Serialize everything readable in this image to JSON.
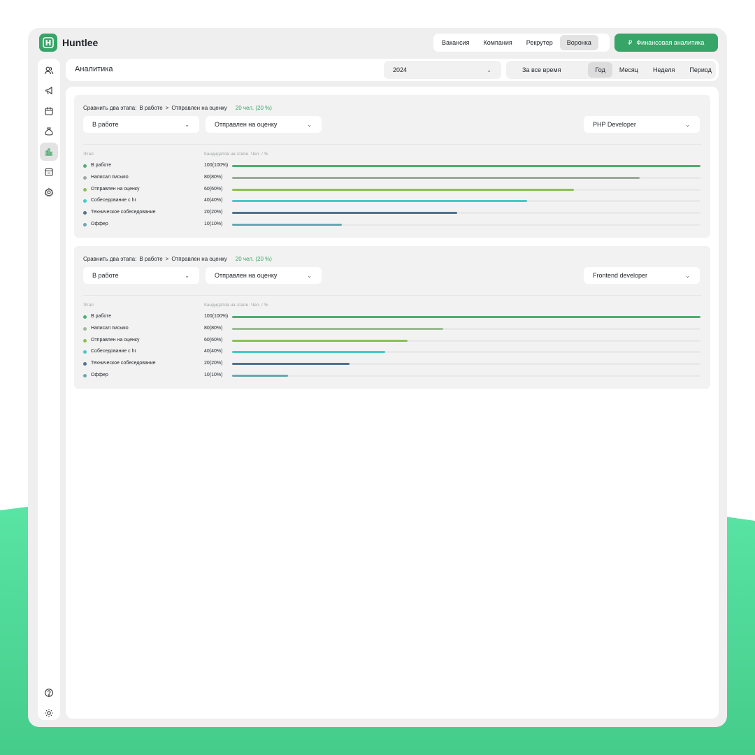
{
  "brand": {
    "name": "Huntlee",
    "accent_color": "#37a567",
    "bg_wave_color": "#55e0a2"
  },
  "top_nav": {
    "items": [
      {
        "label": "Вакансия",
        "active": false
      },
      {
        "label": "Компания",
        "active": false
      },
      {
        "label": "Рекрутер",
        "active": false
      },
      {
        "label": "Воронка",
        "active": true
      }
    ],
    "finance_button": {
      "icon": "ruble-icon",
      "label": "Финансовая аналитика"
    }
  },
  "sidebar": {
    "top_icons": [
      "users-icon",
      "megaphone-icon",
      "calendar-icon",
      "money-bag-icon",
      "bar-chart-icon",
      "calendar-box-icon",
      "settings-icon"
    ],
    "active_icon": "bar-chart-icon",
    "bottom_icons": [
      "help-icon",
      "sun-icon",
      "logout-icon"
    ]
  },
  "header": {
    "title": "Аналитика",
    "year_select": {
      "value": "2024"
    },
    "periods": [
      {
        "label": "За все время",
        "active": false
      },
      {
        "label": "Год",
        "active": true
      },
      {
        "label": "Месяц",
        "active": false
      },
      {
        "label": "Неделя",
        "active": false
      },
      {
        "label": "Период",
        "active": false
      }
    ]
  },
  "funnels": [
    {
      "compare_label": "Сравнить два этапа:",
      "compare_from": "В работе",
      "compare_arrow": ">",
      "compare_to": "Отправлен на оценку",
      "compare_result": "20 чел. (20 %)",
      "stage_from_select": "В работе",
      "stage_to_select": "Отправлен на оценку",
      "vacancy_select": "PHP Developer",
      "col_stage": "Этап",
      "col_count": "Кандидатов на этапе. Чел. / %",
      "stages": [
        {
          "label": "В работе",
          "value": "100(100%)",
          "fraction": 1.0,
          "color": "#4caf72"
        },
        {
          "label": "Написал письмо",
          "value": "80(80%)",
          "fraction": 0.87,
          "color": "#9aaa9c"
        },
        {
          "label": "Отправлен на оценку",
          "value": "60(60%)",
          "fraction": 0.73,
          "color": "#8bc152"
        },
        {
          "label": "Собеседование с hr",
          "value": "40(40%)",
          "fraction": 0.63,
          "color": "#44cbc8"
        },
        {
          "label": "Техническое собеседование",
          "value": "20(20%)",
          "fraction": 0.48,
          "color": "#4f7290"
        },
        {
          "label": "Оффер",
          "value": "10(10%)",
          "fraction": 0.235,
          "color": "#6aa7b2"
        }
      ]
    },
    {
      "compare_label": "Сравнить два этапа:",
      "compare_from": "В работе",
      "compare_arrow": ">",
      "compare_to": "Отправлен на оценку",
      "compare_result": "20 чел. (20 %)",
      "stage_from_select": "В работе",
      "stage_to_select": "Отправлен на оценку",
      "vacancy_select": "Frontend developer",
      "col_stage": "Этап",
      "col_count": "Кандидатов на этапе. Чел. / %",
      "stages": [
        {
          "label": "В работе",
          "value": "100(100%)",
          "fraction": 1.0,
          "color": "#4caf72"
        },
        {
          "label": "Написал письмо",
          "value": "80(80%)",
          "fraction": 0.45,
          "color": "#9cbb95"
        },
        {
          "label": "Отправлен на оценку",
          "value": "60(60%)",
          "fraction": 0.375,
          "color": "#8bc152"
        },
        {
          "label": "Собеседование с hr",
          "value": "40(40%)",
          "fraction": 0.327,
          "color": "#44cbc8"
        },
        {
          "label": "Техническое собеседование",
          "value": "20(20%)",
          "fraction": 0.25,
          "color": "#4f7290"
        },
        {
          "label": "Оффер",
          "value": "10(10%)",
          "fraction": 0.12,
          "color": "#6aa7b2"
        }
      ]
    }
  ]
}
